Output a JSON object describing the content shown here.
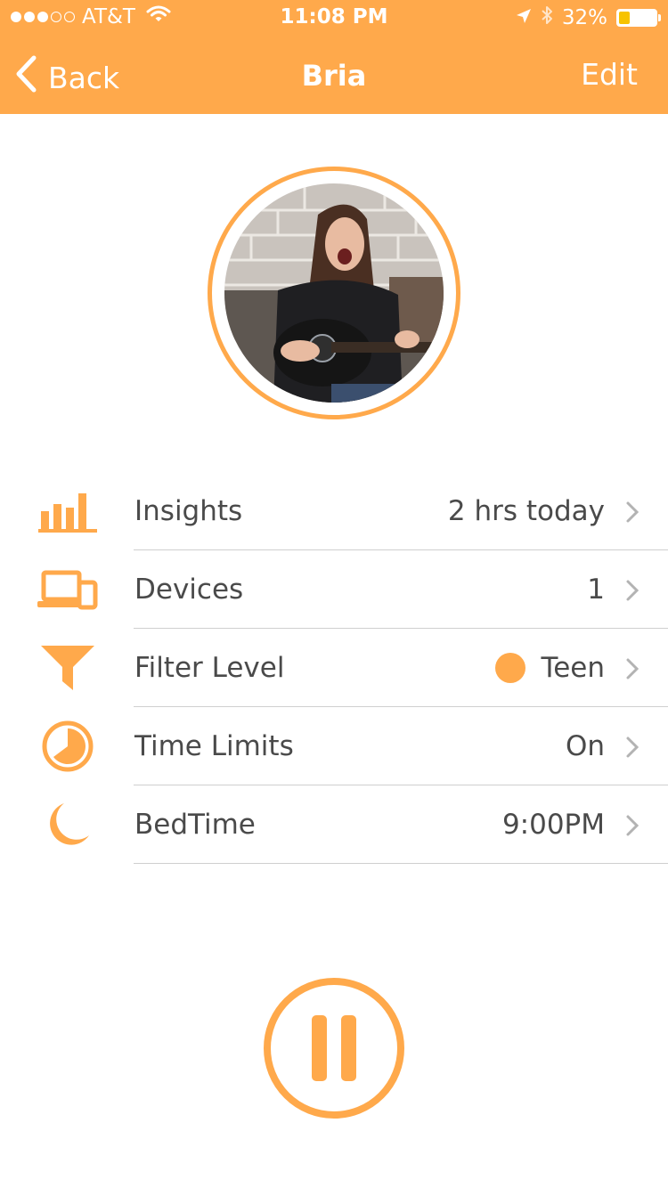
{
  "status_bar": {
    "carrier": "AT&T",
    "time": "11:08 PM",
    "battery": "32%",
    "battery_level": 0.32,
    "signal_bars": 3,
    "signal_total": 5
  },
  "nav": {
    "back_label": "Back",
    "title": "Bria",
    "edit_label": "Edit"
  },
  "profile": {
    "photo_icon": "profile-photo"
  },
  "rows": [
    {
      "label": "Insights",
      "value": "2 hrs today",
      "icon": "bar-chart-icon"
    },
    {
      "label": "Devices",
      "value": "1",
      "icon": "devices-icon"
    },
    {
      "label": "Filter Level",
      "value": "Teen",
      "icon": "filter-icon"
    },
    {
      "label": "Time Limits",
      "value": "On",
      "icon": "clock-icon"
    },
    {
      "label": "BedTime",
      "value": "9:00PM",
      "icon": "moon-icon"
    }
  ],
  "colors": {
    "accent": "#FFA94B",
    "text": "#4a4a4a",
    "divider": "#cfcfcf",
    "battery_fill": "#F7C300"
  },
  "controls": {
    "pause_icon": "pause-icon"
  }
}
